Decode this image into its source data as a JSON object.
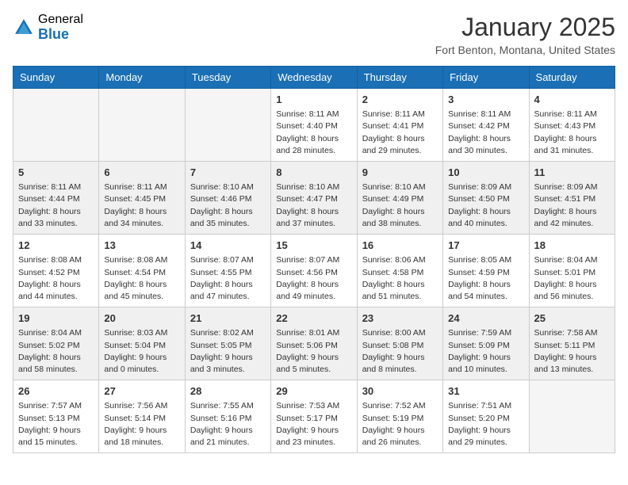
{
  "header": {
    "logo_general": "General",
    "logo_blue": "Blue",
    "month": "January 2025",
    "location": "Fort Benton, Montana, United States"
  },
  "days_of_week": [
    "Sunday",
    "Monday",
    "Tuesday",
    "Wednesday",
    "Thursday",
    "Friday",
    "Saturday"
  ],
  "weeks": [
    [
      {
        "day": "",
        "info": ""
      },
      {
        "day": "",
        "info": ""
      },
      {
        "day": "",
        "info": ""
      },
      {
        "day": "1",
        "info": "Sunrise: 8:11 AM\nSunset: 4:40 PM\nDaylight: 8 hours and 28 minutes."
      },
      {
        "day": "2",
        "info": "Sunrise: 8:11 AM\nSunset: 4:41 PM\nDaylight: 8 hours and 29 minutes."
      },
      {
        "day": "3",
        "info": "Sunrise: 8:11 AM\nSunset: 4:42 PM\nDaylight: 8 hours and 30 minutes."
      },
      {
        "day": "4",
        "info": "Sunrise: 8:11 AM\nSunset: 4:43 PM\nDaylight: 8 hours and 31 minutes."
      }
    ],
    [
      {
        "day": "5",
        "info": "Sunrise: 8:11 AM\nSunset: 4:44 PM\nDaylight: 8 hours and 33 minutes."
      },
      {
        "day": "6",
        "info": "Sunrise: 8:11 AM\nSunset: 4:45 PM\nDaylight: 8 hours and 34 minutes."
      },
      {
        "day": "7",
        "info": "Sunrise: 8:10 AM\nSunset: 4:46 PM\nDaylight: 8 hours and 35 minutes."
      },
      {
        "day": "8",
        "info": "Sunrise: 8:10 AM\nSunset: 4:47 PM\nDaylight: 8 hours and 37 minutes."
      },
      {
        "day": "9",
        "info": "Sunrise: 8:10 AM\nSunset: 4:49 PM\nDaylight: 8 hours and 38 minutes."
      },
      {
        "day": "10",
        "info": "Sunrise: 8:09 AM\nSunset: 4:50 PM\nDaylight: 8 hours and 40 minutes."
      },
      {
        "day": "11",
        "info": "Sunrise: 8:09 AM\nSunset: 4:51 PM\nDaylight: 8 hours and 42 minutes."
      }
    ],
    [
      {
        "day": "12",
        "info": "Sunrise: 8:08 AM\nSunset: 4:52 PM\nDaylight: 8 hours and 44 minutes."
      },
      {
        "day": "13",
        "info": "Sunrise: 8:08 AM\nSunset: 4:54 PM\nDaylight: 8 hours and 45 minutes."
      },
      {
        "day": "14",
        "info": "Sunrise: 8:07 AM\nSunset: 4:55 PM\nDaylight: 8 hours and 47 minutes."
      },
      {
        "day": "15",
        "info": "Sunrise: 8:07 AM\nSunset: 4:56 PM\nDaylight: 8 hours and 49 minutes."
      },
      {
        "day": "16",
        "info": "Sunrise: 8:06 AM\nSunset: 4:58 PM\nDaylight: 8 hours and 51 minutes."
      },
      {
        "day": "17",
        "info": "Sunrise: 8:05 AM\nSunset: 4:59 PM\nDaylight: 8 hours and 54 minutes."
      },
      {
        "day": "18",
        "info": "Sunrise: 8:04 AM\nSunset: 5:01 PM\nDaylight: 8 hours and 56 minutes."
      }
    ],
    [
      {
        "day": "19",
        "info": "Sunrise: 8:04 AM\nSunset: 5:02 PM\nDaylight: 8 hours and 58 minutes."
      },
      {
        "day": "20",
        "info": "Sunrise: 8:03 AM\nSunset: 5:04 PM\nDaylight: 9 hours and 0 minutes."
      },
      {
        "day": "21",
        "info": "Sunrise: 8:02 AM\nSunset: 5:05 PM\nDaylight: 9 hours and 3 minutes."
      },
      {
        "day": "22",
        "info": "Sunrise: 8:01 AM\nSunset: 5:06 PM\nDaylight: 9 hours and 5 minutes."
      },
      {
        "day": "23",
        "info": "Sunrise: 8:00 AM\nSunset: 5:08 PM\nDaylight: 9 hours and 8 minutes."
      },
      {
        "day": "24",
        "info": "Sunrise: 7:59 AM\nSunset: 5:09 PM\nDaylight: 9 hours and 10 minutes."
      },
      {
        "day": "25",
        "info": "Sunrise: 7:58 AM\nSunset: 5:11 PM\nDaylight: 9 hours and 13 minutes."
      }
    ],
    [
      {
        "day": "26",
        "info": "Sunrise: 7:57 AM\nSunset: 5:13 PM\nDaylight: 9 hours and 15 minutes."
      },
      {
        "day": "27",
        "info": "Sunrise: 7:56 AM\nSunset: 5:14 PM\nDaylight: 9 hours and 18 minutes."
      },
      {
        "day": "28",
        "info": "Sunrise: 7:55 AM\nSunset: 5:16 PM\nDaylight: 9 hours and 21 minutes."
      },
      {
        "day": "29",
        "info": "Sunrise: 7:53 AM\nSunset: 5:17 PM\nDaylight: 9 hours and 23 minutes."
      },
      {
        "day": "30",
        "info": "Sunrise: 7:52 AM\nSunset: 5:19 PM\nDaylight: 9 hours and 26 minutes."
      },
      {
        "day": "31",
        "info": "Sunrise: 7:51 AM\nSunset: 5:20 PM\nDaylight: 9 hours and 29 minutes."
      },
      {
        "day": "",
        "info": ""
      }
    ]
  ]
}
